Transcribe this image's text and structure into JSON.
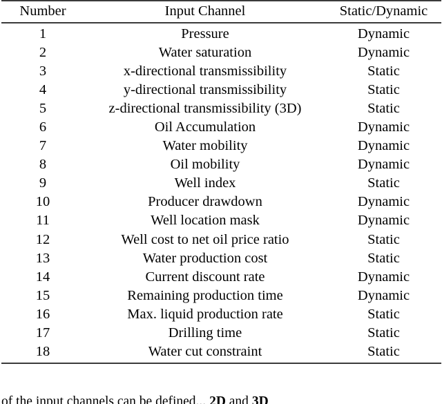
{
  "table": {
    "columns": [
      {
        "key": "number",
        "label": "Number"
      },
      {
        "key": "channel",
        "label": "Input Channel"
      },
      {
        "key": "type",
        "label": "Static/Dynamic"
      }
    ],
    "rows": [
      {
        "number": "1",
        "channel": "Pressure",
        "type": "Dynamic"
      },
      {
        "number": "2",
        "channel": "Water saturation",
        "type": "Dynamic"
      },
      {
        "number": "3",
        "channel": "x-directional transmissibility",
        "type": "Static"
      },
      {
        "number": "4",
        "channel": "y-directional transmissibility",
        "type": "Static"
      },
      {
        "number": "5",
        "channel": "z-directional transmissibility (3D)",
        "type": "Static"
      },
      {
        "number": "6",
        "channel": "Oil Accumulation",
        "type": "Dynamic"
      },
      {
        "number": "7",
        "channel": "Water mobility",
        "type": "Dynamic"
      },
      {
        "number": "8",
        "channel": "Oil mobility",
        "type": "Dynamic"
      },
      {
        "number": "9",
        "channel": "Well index",
        "type": "Static"
      },
      {
        "number": "10",
        "channel": "Producer drawdown",
        "type": "Dynamic"
      },
      {
        "number": "11",
        "channel": "Well location mask",
        "type": "Dynamic"
      },
      {
        "number": "12",
        "channel": "Well cost to net oil price ratio",
        "type": "Static"
      },
      {
        "number": "13",
        "channel": "Water production cost",
        "type": "Static"
      },
      {
        "number": "14",
        "channel": "Current discount rate",
        "type": "Dynamic"
      },
      {
        "number": "15",
        "channel": "Remaining production time",
        "type": "Dynamic"
      },
      {
        "number": "16",
        "channel": "Max. liquid production rate",
        "type": "Static"
      },
      {
        "number": "17",
        "channel": "Drilling time",
        "type": "Static"
      },
      {
        "number": "18",
        "channel": "Water cut constraint",
        "type": "Static"
      }
    ]
  },
  "caption": {
    "prefix": "of the input channels can be defined...",
    "emphasis_1": "2D",
    "between": "and",
    "emphasis_2": "3D"
  }
}
